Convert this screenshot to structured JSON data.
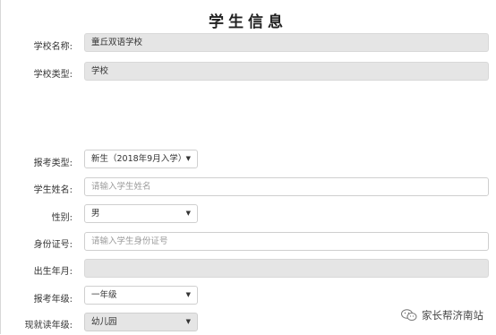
{
  "title": "学生信息",
  "school": {
    "name_label": "学校名称:",
    "name_value": "童丘双语学校",
    "type_label": "学校类型:",
    "type_value": "学校"
  },
  "form": {
    "exam_type": {
      "label": "报考类型:",
      "value": "新生（2018年9月入学）"
    },
    "student_name": {
      "label": "学生姓名:",
      "placeholder": "请输入学生姓名"
    },
    "gender": {
      "label": "性别:",
      "value": "男"
    },
    "id_number": {
      "label": "身份证号:",
      "placeholder": "请输入学生身份证号"
    },
    "birth_date": {
      "label": "出生年月:",
      "value": ""
    },
    "grade": {
      "label": "报考年级:",
      "value": "一年级"
    },
    "current_grade": {
      "label": "现就读年级:",
      "value": "幼儿园"
    }
  },
  "icons": {
    "dropdown": "caret-down-icon",
    "watermark": "wechat-icon"
  },
  "watermark": {
    "text": "家长帮济南站"
  }
}
